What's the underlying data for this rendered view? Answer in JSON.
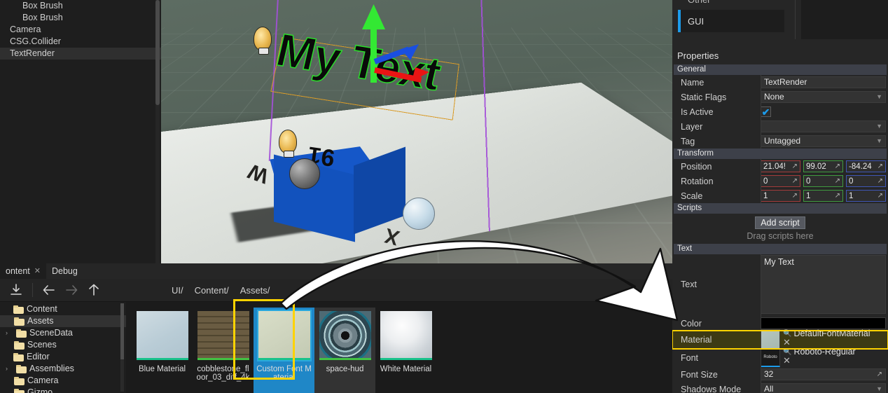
{
  "scene_tree": {
    "items": [
      {
        "label": "Box Brush",
        "indent": 1,
        "selected": false
      },
      {
        "label": "Box Brush",
        "indent": 1,
        "selected": false
      },
      {
        "label": "Camera",
        "indent": 0,
        "selected": false
      },
      {
        "label": "CSG.Collider",
        "indent": 0,
        "selected": false
      },
      {
        "label": "TextRender",
        "indent": 0,
        "selected": true
      }
    ]
  },
  "viewport": {
    "text_object": "My Text",
    "cube_letters": [
      "91",
      "W",
      "X"
    ],
    "gizmo_axes": [
      "green-up-arrow",
      "blue-arrow",
      "red-arrow"
    ]
  },
  "content_browser": {
    "tabs": [
      {
        "label": "ontent",
        "active": true,
        "closable": true
      },
      {
        "label": "Debug",
        "active": false,
        "closable": false
      }
    ],
    "toolbar": {
      "import_icon": "import-icon",
      "back_icon": "arrow-left-icon",
      "forward_icon": "arrow-right-icon",
      "up_icon": "arrow-up-icon"
    },
    "breadcrumbs": [
      "UI/",
      "Content/",
      "Assets/"
    ],
    "folders": [
      {
        "label": "Content",
        "depth": 0,
        "arrow": "",
        "selected": false
      },
      {
        "label": "Assets",
        "depth": 1,
        "arrow": "",
        "selected": true
      },
      {
        "label": "SceneData",
        "depth": 1,
        "arrow": "›",
        "selected": false
      },
      {
        "label": "Scenes",
        "depth": 1,
        "arrow": "",
        "selected": false
      },
      {
        "label": "Editor",
        "depth": 0,
        "arrow": "",
        "selected": false
      },
      {
        "label": "Assemblies",
        "depth": 1,
        "arrow": "›",
        "selected": false
      },
      {
        "label": "Camera",
        "depth": 1,
        "arrow": "",
        "selected": false
      },
      {
        "label": "Gizmo",
        "depth": 1,
        "arrow": "",
        "selected": false
      }
    ],
    "assets": [
      {
        "label": "Blue Material",
        "state": "normal",
        "thumb": "blue-material",
        "bar": "#19c28b"
      },
      {
        "label": "cobblestone_floor_03_diff_4k",
        "state": "normal",
        "thumb": "cobblestone-texture",
        "bar": "#43c143"
      },
      {
        "label": "Custom Font Material",
        "state": "selected",
        "thumb": "custom-font-material",
        "bar": "#19c28b"
      },
      {
        "label": "space-hud",
        "state": "hovered",
        "thumb": "space-hud-texture",
        "bar": "#43c143"
      },
      {
        "label": "White Material",
        "state": "normal",
        "thumb": "white-material",
        "bar": "#19c28b"
      }
    ]
  },
  "properties_panel": {
    "tabs": [
      {
        "label": "Other",
        "active": false
      },
      {
        "label": "GUI",
        "active": true
      }
    ],
    "title": "Properties",
    "sections": {
      "general": {
        "header": "General",
        "name": {
          "label": "Name",
          "value": "TextRender"
        },
        "static_flags": {
          "label": "Static Flags",
          "value": "None"
        },
        "is_active": {
          "label": "Is Active",
          "checked": true,
          "check_glyph": "✔"
        },
        "layer": {
          "label": "Layer",
          "value": ""
        },
        "tag": {
          "label": "Tag",
          "value": "Untagged"
        }
      },
      "transform": {
        "header": "Transform",
        "position": {
          "label": "Position",
          "x": "21.04!",
          "y": "99.02",
          "z": "-84.24"
        },
        "rotation": {
          "label": "Rotation",
          "x": "0",
          "y": "0",
          "z": "0"
        },
        "scale": {
          "label": "Scale",
          "x": "1",
          "y": "1",
          "z": "1"
        }
      },
      "scripts": {
        "header": "Scripts",
        "add_button": "Add script",
        "drag_hint": "Drag scripts here"
      },
      "text": {
        "header": "Text",
        "text": {
          "label": "Text",
          "value": "My Text"
        },
        "color": {
          "label": "Color",
          "value": "#000000"
        },
        "material": {
          "label": "Material",
          "value": "DefaultFontMaterial",
          "thumb": "material-preview",
          "highlighted": true
        },
        "font": {
          "label": "Font",
          "value": "Roboto-Regular",
          "thumb": "font-preview"
        },
        "font_size": {
          "label": "Font Size",
          "value": "32"
        },
        "shadows_mode": {
          "label": "Shadows Mode",
          "value": "All"
        }
      }
    },
    "icons": {
      "search": "⌕",
      "clear": "✕",
      "expand": "↗",
      "chevron": "∨"
    }
  },
  "annotation": {
    "arrow": "curved-white-arrow-pointing-to-material-field"
  },
  "colors": {
    "accent_blue": "#1c9bea",
    "highlight_yellow": "#ffd300",
    "selection_blue": "#1f87c7",
    "axis_x": "#a33b3b",
    "axis_y": "#3f9b3f",
    "axis_z": "#3f56b5"
  }
}
